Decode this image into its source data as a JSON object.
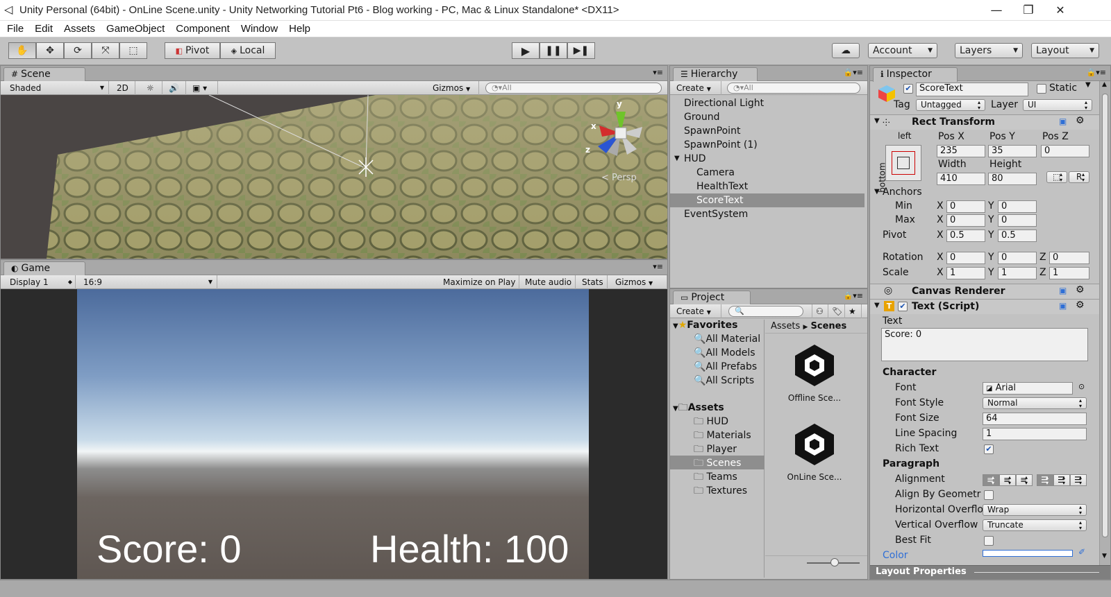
{
  "window": {
    "title": "Unity Personal (64bit) - OnLine Scene.unity - Unity Networking Tutorial Pt6 - Blog working - PC, Mac & Linux Standalone* <DX11>",
    "controls": {
      "minimize": "—",
      "restore": "❐",
      "close": "✕"
    }
  },
  "menu": [
    "File",
    "Edit",
    "Assets",
    "GameObject",
    "Component",
    "Window",
    "Help"
  ],
  "toolbar": {
    "pivot": "Pivot",
    "local": "Local",
    "account": "Account",
    "layers": "Layers",
    "layout": "Layout"
  },
  "scene": {
    "tab": "Scene",
    "shading": "Shaded",
    "mode_2d": "2D",
    "gizmos": "Gizmos",
    "search_placeholder": "All",
    "persp": "< Persp",
    "axes": {
      "y": "y",
      "x": "x",
      "z": "z"
    }
  },
  "game": {
    "tab": "Game",
    "display": "Display 1",
    "aspect": "16:9",
    "maximize": "Maximize on Play",
    "mute": "Mute audio",
    "stats": "Stats",
    "gizmos": "Gizmos",
    "score_text": "Score: 0",
    "health_text": "Health: 100"
  },
  "hierarchy": {
    "tab": "Hierarchy",
    "create": "Create",
    "search_placeholder": "All",
    "items": [
      {
        "label": "Directional Light",
        "indent": 0
      },
      {
        "label": "Ground",
        "indent": 0
      },
      {
        "label": "SpawnPoint",
        "indent": 0
      },
      {
        "label": "SpawnPoint (1)",
        "indent": 0
      },
      {
        "label": "HUD",
        "indent": 0
      },
      {
        "label": "Camera",
        "indent": 1
      },
      {
        "label": "HealthText",
        "indent": 1
      },
      {
        "label": "ScoreText",
        "indent": 1,
        "selected": true
      },
      {
        "label": "EventSystem",
        "indent": 0
      }
    ]
  },
  "project": {
    "tab": "Project",
    "create": "Create",
    "favorites": "Favorites",
    "favorite_items": [
      "All Material",
      "All Models",
      "All Prefabs",
      "All Scripts"
    ],
    "assets": "Assets",
    "asset_folders": [
      "HUD",
      "Materials",
      "Player",
      "Scenes",
      "Teams",
      "Textures"
    ],
    "selected_folder": "Scenes",
    "breadcrumb": [
      "Assets",
      "Scenes"
    ],
    "files": [
      "Offline Sce...",
      "OnLine Sce..."
    ]
  },
  "inspector": {
    "tab": "Inspector",
    "object_name": "ScoreText",
    "static_label": "Static",
    "tag_label": "Tag",
    "tag_value": "Untagged",
    "layer_label": "Layer",
    "layer_value": "UI",
    "rect_transform": {
      "title": "Rect Transform",
      "anchor_h": "left",
      "anchor_v": "bottom",
      "pos_x_label": "Pos X",
      "pos_x": "235",
      "pos_y_label": "Pos Y",
      "pos_y": "35",
      "pos_z_label": "Pos Z",
      "pos_z": "0",
      "width_label": "Width",
      "width": "410",
      "height_label": "Height",
      "height": "80",
      "r_btn": "R",
      "anchors_label": "Anchors",
      "min_label": "Min",
      "min_x": "0",
      "min_y": "0",
      "max_label": "Max",
      "max_x": "0",
      "max_y": "0",
      "pivot_label": "Pivot",
      "pivot_x": "0.5",
      "pivot_y": "0.5",
      "rotation_label": "Rotation",
      "rot_x": "0",
      "rot_y": "0",
      "rot_z": "0",
      "scale_label": "Scale",
      "scale_x": "1",
      "scale_y": "1",
      "scale_z": "1",
      "x": "X",
      "y": "Y",
      "z": "Z"
    },
    "canvas_renderer": "Canvas Renderer",
    "text_script": {
      "title": "Text (Script)",
      "text_label": "Text",
      "text_value": "Score: 0",
      "character": "Character",
      "font_label": "Font",
      "font_value": "Arial",
      "font_style_label": "Font Style",
      "font_style_value": "Normal",
      "font_size_label": "Font Size",
      "font_size_value": "64",
      "line_spacing_label": "Line Spacing",
      "line_spacing_value": "1",
      "rich_text_label": "Rich Text",
      "rich_text": true,
      "paragraph": "Paragraph",
      "alignment_label": "Alignment",
      "align_by_geometry_label": "Align By Geometr",
      "horizontal_overflow_label": "Horizontal Overflo",
      "horizontal_overflow_value": "Wrap",
      "vertical_overflow_label": "Vertical Overflow",
      "vertical_overflow_value": "Truncate",
      "best_fit_label": "Best Fit",
      "color_label": "Color"
    },
    "layout_properties": "Layout Properties"
  },
  "colors": {
    "ui_bg": "#c2c2c2",
    "selection": "#8e8e8e",
    "accent_blue": "#2f6fd6"
  }
}
